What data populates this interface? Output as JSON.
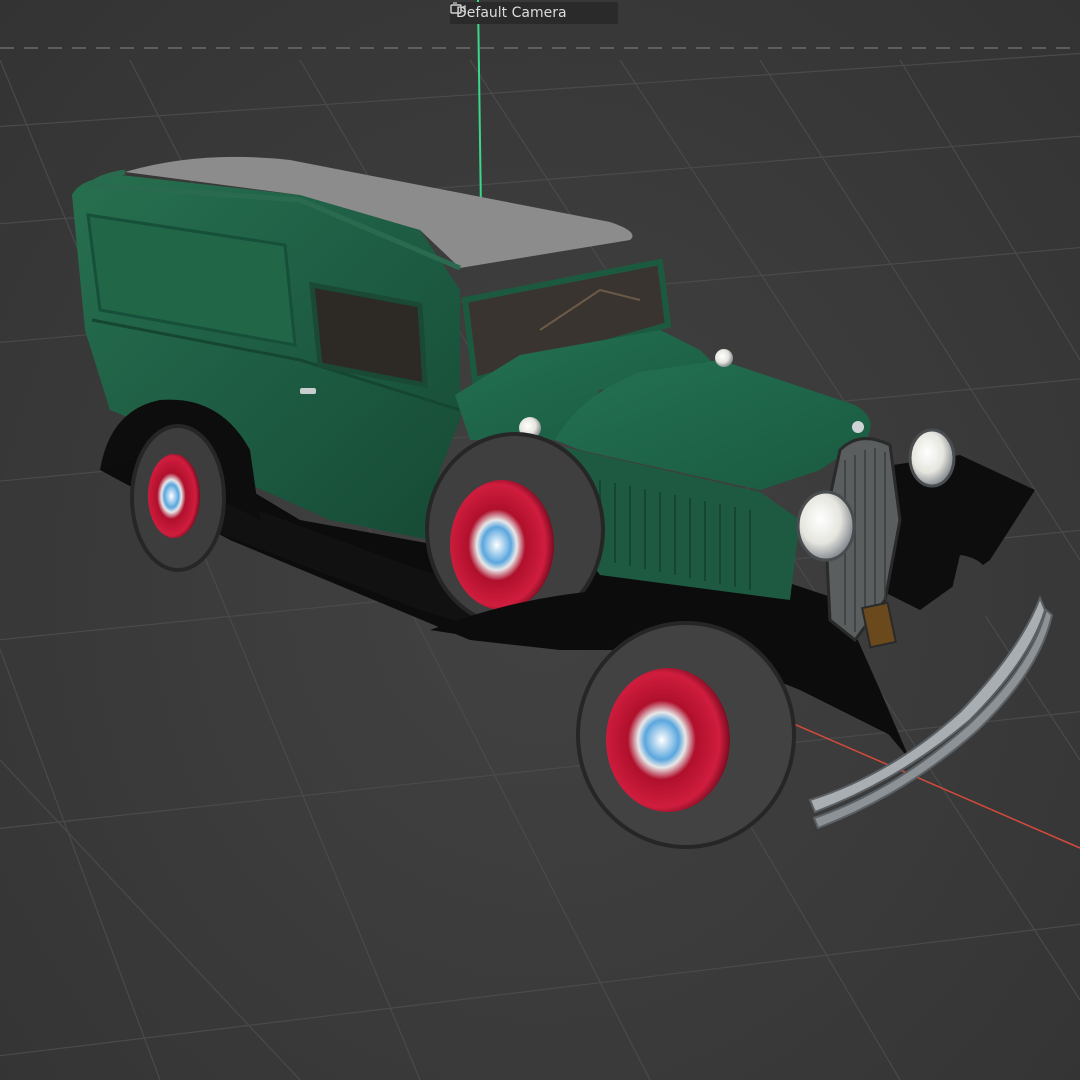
{
  "viewport": {
    "camera_label": "Default Camera",
    "camera_icon": "camera-switch-icon",
    "background_color": "#3a3a3a",
    "grid_color": "#4a4a4a",
    "axis_y_color": "#3ad98a",
    "axis_x_color": "#d44a3a"
  },
  "model": {
    "body_color": "#1f5e46",
    "roof_color": "#8c8c8c",
    "wheel_rim_color": "#c8183a",
    "tire_color": "#3a3a3a",
    "hubcap_color": "#5aa6de"
  }
}
